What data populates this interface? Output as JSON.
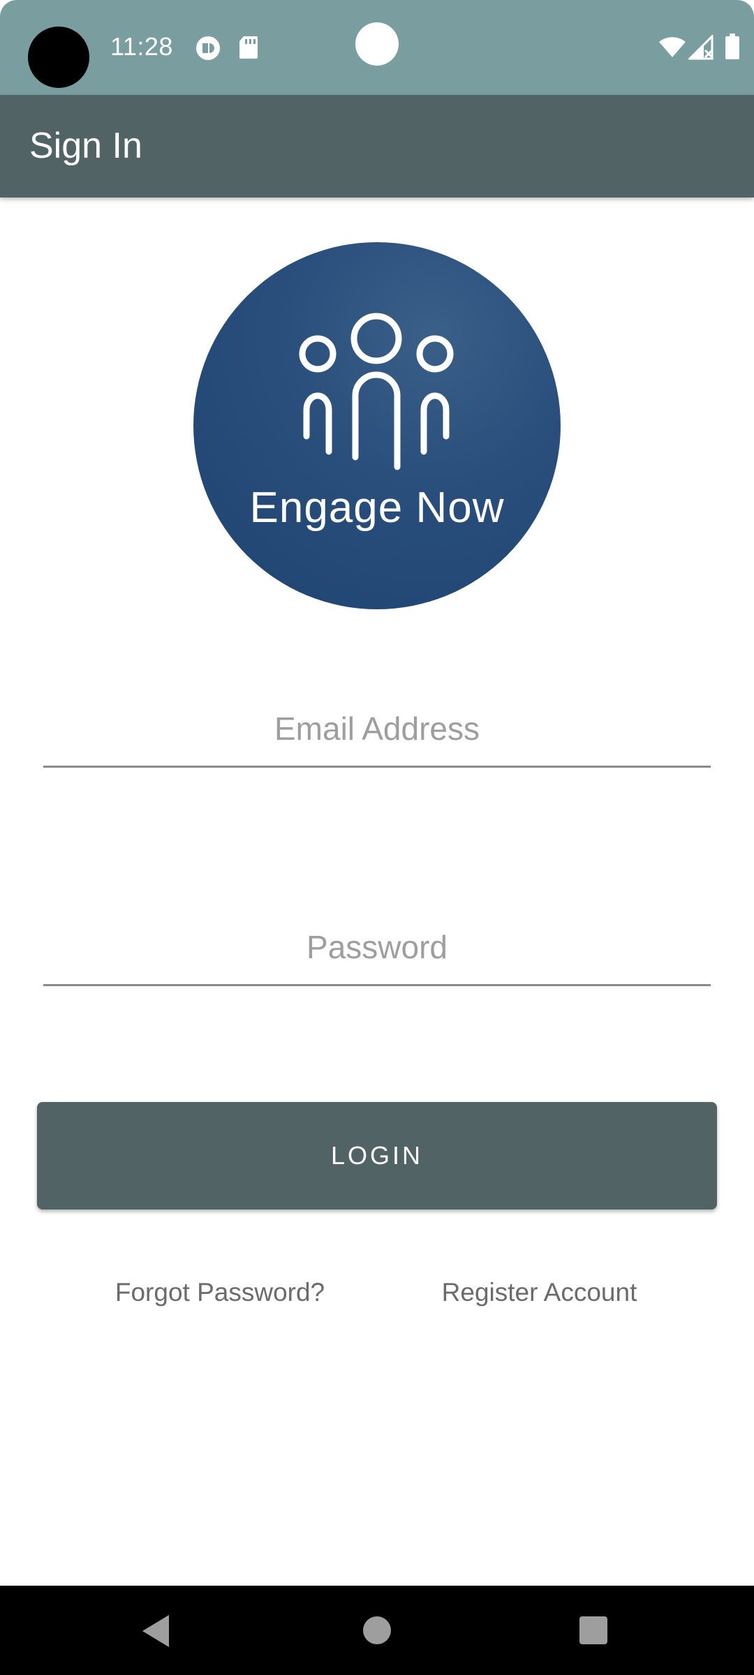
{
  "status_bar": {
    "time": "11:28",
    "icons": [
      "notification-icon",
      "sd-card-icon",
      "wifi-icon",
      "signal-icon",
      "battery-icon"
    ]
  },
  "app_bar": {
    "title": "Sign In"
  },
  "logo": {
    "text": "Engage Now",
    "background": "#1f4572"
  },
  "form": {
    "email_placeholder": "Email Address",
    "email_value": "",
    "password_placeholder": "Password",
    "password_value": "",
    "login_label": "LOGIN"
  },
  "links": {
    "forgot_password": "Forgot Password?",
    "register_account": "Register Account"
  },
  "nav_bar": {
    "icons": [
      "back-icon",
      "home-icon",
      "recents-icon"
    ]
  },
  "colors": {
    "status_bar": "#7a9e9f",
    "app_bar": "#526366",
    "button": "#526366",
    "link_text": "#6b6b6b"
  }
}
